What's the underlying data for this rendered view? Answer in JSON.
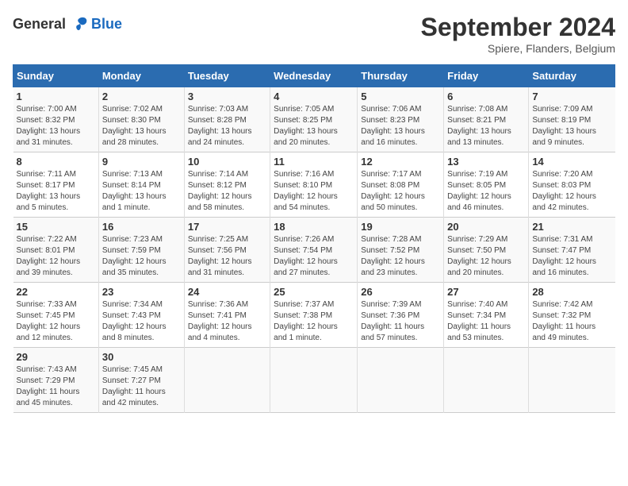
{
  "header": {
    "logo_general": "General",
    "logo_blue": "Blue",
    "title": "September 2024",
    "location": "Spiere, Flanders, Belgium"
  },
  "days_of_week": [
    "Sunday",
    "Monday",
    "Tuesday",
    "Wednesday",
    "Thursday",
    "Friday",
    "Saturday"
  ],
  "weeks": [
    [
      {
        "day": "1",
        "details": "Sunrise: 7:00 AM\nSunset: 8:32 PM\nDaylight: 13 hours\nand 31 minutes."
      },
      {
        "day": "2",
        "details": "Sunrise: 7:02 AM\nSunset: 8:30 PM\nDaylight: 13 hours\nand 28 minutes."
      },
      {
        "day": "3",
        "details": "Sunrise: 7:03 AM\nSunset: 8:28 PM\nDaylight: 13 hours\nand 24 minutes."
      },
      {
        "day": "4",
        "details": "Sunrise: 7:05 AM\nSunset: 8:25 PM\nDaylight: 13 hours\nand 20 minutes."
      },
      {
        "day": "5",
        "details": "Sunrise: 7:06 AM\nSunset: 8:23 PM\nDaylight: 13 hours\nand 16 minutes."
      },
      {
        "day": "6",
        "details": "Sunrise: 7:08 AM\nSunset: 8:21 PM\nDaylight: 13 hours\nand 13 minutes."
      },
      {
        "day": "7",
        "details": "Sunrise: 7:09 AM\nSunset: 8:19 PM\nDaylight: 13 hours\nand 9 minutes."
      }
    ],
    [
      {
        "day": "8",
        "details": "Sunrise: 7:11 AM\nSunset: 8:17 PM\nDaylight: 13 hours\nand 5 minutes."
      },
      {
        "day": "9",
        "details": "Sunrise: 7:13 AM\nSunset: 8:14 PM\nDaylight: 13 hours\nand 1 minute."
      },
      {
        "day": "10",
        "details": "Sunrise: 7:14 AM\nSunset: 8:12 PM\nDaylight: 12 hours\nand 58 minutes."
      },
      {
        "day": "11",
        "details": "Sunrise: 7:16 AM\nSunset: 8:10 PM\nDaylight: 12 hours\nand 54 minutes."
      },
      {
        "day": "12",
        "details": "Sunrise: 7:17 AM\nSunset: 8:08 PM\nDaylight: 12 hours\nand 50 minutes."
      },
      {
        "day": "13",
        "details": "Sunrise: 7:19 AM\nSunset: 8:05 PM\nDaylight: 12 hours\nand 46 minutes."
      },
      {
        "day": "14",
        "details": "Sunrise: 7:20 AM\nSunset: 8:03 PM\nDaylight: 12 hours\nand 42 minutes."
      }
    ],
    [
      {
        "day": "15",
        "details": "Sunrise: 7:22 AM\nSunset: 8:01 PM\nDaylight: 12 hours\nand 39 minutes."
      },
      {
        "day": "16",
        "details": "Sunrise: 7:23 AM\nSunset: 7:59 PM\nDaylight: 12 hours\nand 35 minutes."
      },
      {
        "day": "17",
        "details": "Sunrise: 7:25 AM\nSunset: 7:56 PM\nDaylight: 12 hours\nand 31 minutes."
      },
      {
        "day": "18",
        "details": "Sunrise: 7:26 AM\nSunset: 7:54 PM\nDaylight: 12 hours\nand 27 minutes."
      },
      {
        "day": "19",
        "details": "Sunrise: 7:28 AM\nSunset: 7:52 PM\nDaylight: 12 hours\nand 23 minutes."
      },
      {
        "day": "20",
        "details": "Sunrise: 7:29 AM\nSunset: 7:50 PM\nDaylight: 12 hours\nand 20 minutes."
      },
      {
        "day": "21",
        "details": "Sunrise: 7:31 AM\nSunset: 7:47 PM\nDaylight: 12 hours\nand 16 minutes."
      }
    ],
    [
      {
        "day": "22",
        "details": "Sunrise: 7:33 AM\nSunset: 7:45 PM\nDaylight: 12 hours\nand 12 minutes."
      },
      {
        "day": "23",
        "details": "Sunrise: 7:34 AM\nSunset: 7:43 PM\nDaylight: 12 hours\nand 8 minutes."
      },
      {
        "day": "24",
        "details": "Sunrise: 7:36 AM\nSunset: 7:41 PM\nDaylight: 12 hours\nand 4 minutes."
      },
      {
        "day": "25",
        "details": "Sunrise: 7:37 AM\nSunset: 7:38 PM\nDaylight: 12 hours\nand 1 minute."
      },
      {
        "day": "26",
        "details": "Sunrise: 7:39 AM\nSunset: 7:36 PM\nDaylight: 11 hours\nand 57 minutes."
      },
      {
        "day": "27",
        "details": "Sunrise: 7:40 AM\nSunset: 7:34 PM\nDaylight: 11 hours\nand 53 minutes."
      },
      {
        "day": "28",
        "details": "Sunrise: 7:42 AM\nSunset: 7:32 PM\nDaylight: 11 hours\nand 49 minutes."
      }
    ],
    [
      {
        "day": "29",
        "details": "Sunrise: 7:43 AM\nSunset: 7:29 PM\nDaylight: 11 hours\nand 45 minutes."
      },
      {
        "day": "30",
        "details": "Sunrise: 7:45 AM\nSunset: 7:27 PM\nDaylight: 11 hours\nand 42 minutes."
      },
      {
        "day": "",
        "details": ""
      },
      {
        "day": "",
        "details": ""
      },
      {
        "day": "",
        "details": ""
      },
      {
        "day": "",
        "details": ""
      },
      {
        "day": "",
        "details": ""
      }
    ]
  ]
}
